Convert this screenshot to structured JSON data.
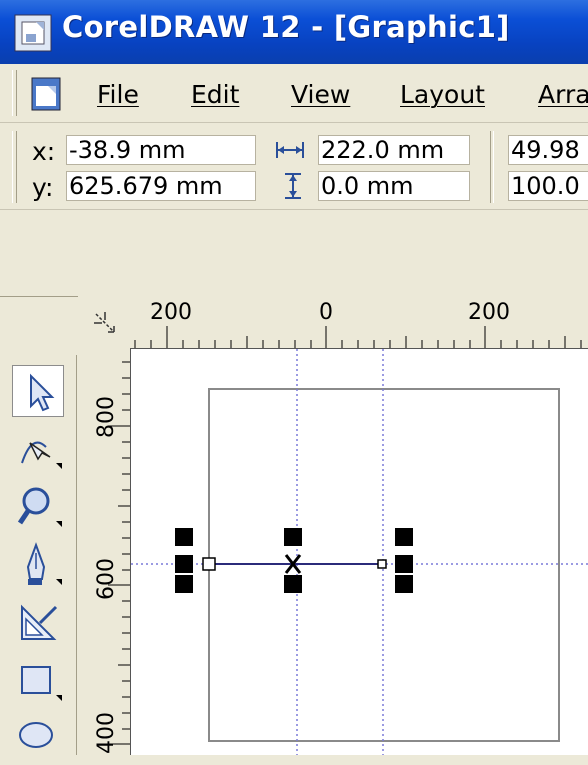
{
  "window": {
    "title": "CorelDRAW 12 - [Graphic1]"
  },
  "menu": {
    "items": [
      {
        "label": "File"
      },
      {
        "label": "Edit"
      },
      {
        "label": "View"
      },
      {
        "label": "Layout"
      },
      {
        "label": "Arra"
      }
    ]
  },
  "property_bar": {
    "x_label": "x:",
    "x_value": "-38.9 mm",
    "y_label": "y:",
    "y_value": "625.679 mm",
    "width_value": "222.0 mm",
    "height_value": "0.0 mm",
    "scale_x_value": "49.98",
    "scale_y_value": "100.0"
  },
  "rulers": {
    "horizontal_labels": [
      "200",
      "0",
      "200"
    ],
    "vertical_labels": [
      "800",
      "600",
      "400"
    ]
  },
  "toolbox": {
    "tools": [
      "pick-tool",
      "shape-tool",
      "zoom-tool",
      "freehand-tool",
      "smart-fill-tool",
      "rectangle-tool",
      "ellipse-tool"
    ],
    "active": "pick-tool"
  },
  "colors": {
    "title_bar": "#0b4fd6",
    "guideline": "#7a7ad8",
    "handle": "#000000",
    "page_border": "#8a8a8a"
  }
}
